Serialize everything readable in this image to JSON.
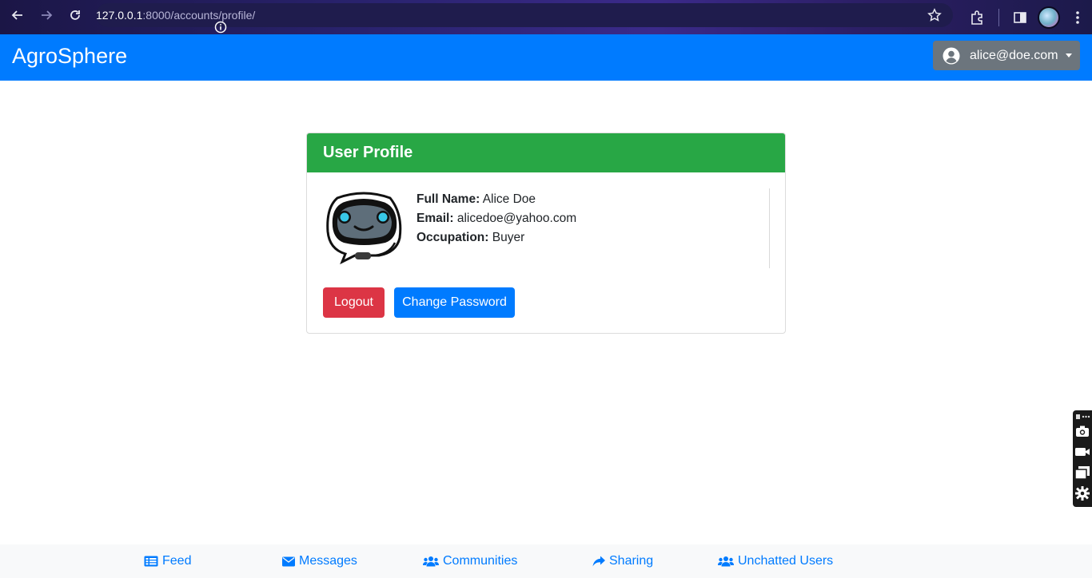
{
  "browser": {
    "url_host": "127.0.0.1",
    "url_path": ":8000/accounts/profile/"
  },
  "navbar": {
    "brand": "AgroSphere",
    "user_email": "alice@doe.com"
  },
  "profile": {
    "title": "User Profile",
    "full_name_label": "Full Name:",
    "full_name": "Alice Doe",
    "email_label": "Email:",
    "email": "alicedoe@yahoo.com",
    "occupation_label": "Occupation:",
    "occupation": "Buyer",
    "logout_label": "Logout",
    "change_password_label": "Change Password"
  },
  "footer": {
    "items": [
      {
        "label": "Feed",
        "icon": "list-icon"
      },
      {
        "label": "Messages",
        "icon": "envelope-icon"
      },
      {
        "label": "Communities",
        "icon": "users-icon"
      },
      {
        "label": "Sharing",
        "icon": "share-icon"
      },
      {
        "label": "Unchatted Users",
        "icon": "users-icon"
      }
    ]
  },
  "colors": {
    "primary": "#007bff",
    "success": "#28a745",
    "danger": "#dc3545",
    "secondary": "#6c757d"
  }
}
